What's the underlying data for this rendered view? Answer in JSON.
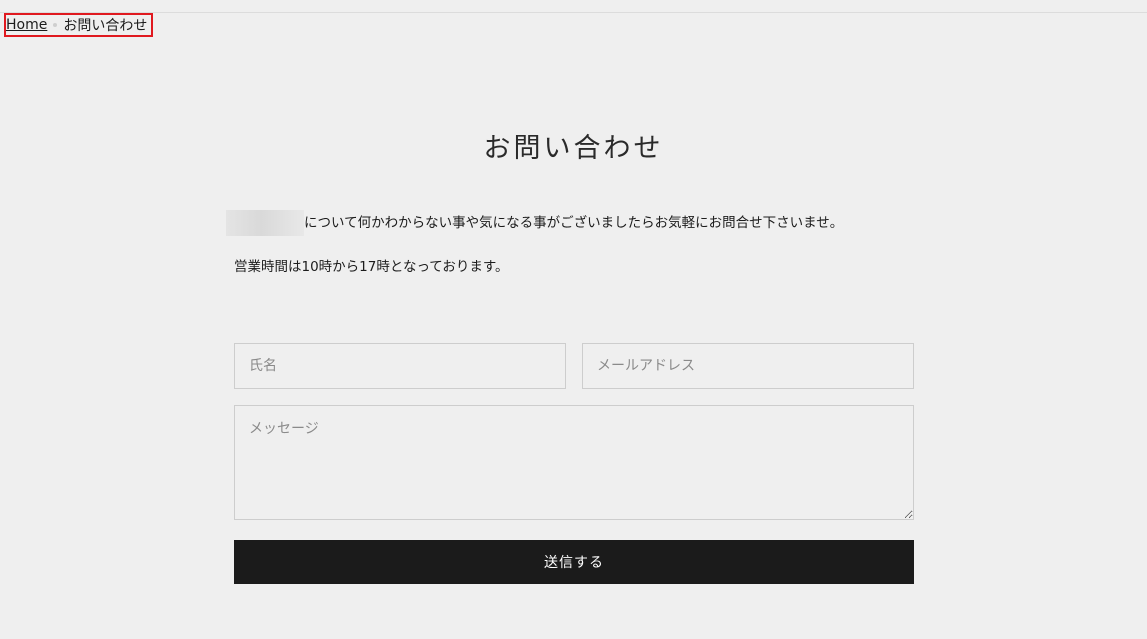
{
  "breadcrumb": {
    "home_label": "Home",
    "current_label": "お問い合わせ"
  },
  "page": {
    "title": "お問い合わせ",
    "intro_text": "について何かわからない事や気になる事がございましたらお気軽にお問合せ下さいませ。",
    "hours_text": "営業時間は10時から17時となっております。"
  },
  "form": {
    "name_placeholder": "氏名",
    "email_placeholder": "メールアドレス",
    "message_placeholder": "メッセージ",
    "submit_label": "送信する"
  },
  "colors": {
    "background": "#efefef",
    "button": "#1b1b1b",
    "highlight_border": "#e0191f"
  }
}
